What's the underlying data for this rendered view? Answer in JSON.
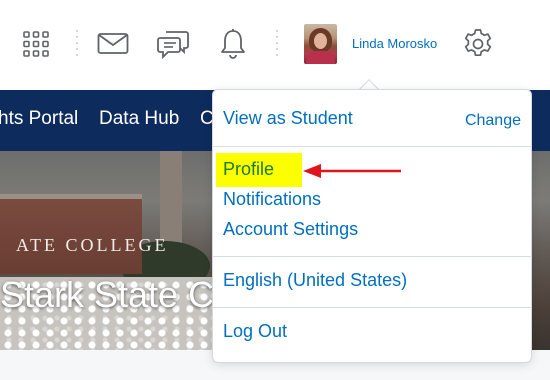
{
  "header": {
    "user_name": "Linda Morosko",
    "icons": [
      "grid-icon",
      "mail-icon",
      "chat-icon",
      "bell-icon",
      "gear-icon"
    ]
  },
  "nav": {
    "items": [
      "hts Portal",
      "Data Hub",
      "C"
    ]
  },
  "banner": {
    "title": "Stark State C",
    "sign_text": "ATE COLLEGE"
  },
  "dropdown": {
    "view_as": "View as Student",
    "change": "Change",
    "profile": "Profile",
    "notifications": "Notifications",
    "account_settings": "Account Settings",
    "language": "English (United States)",
    "logout": "Log Out"
  },
  "colors": {
    "nav_bg": "#0e2b5e",
    "link": "#006fbf",
    "highlight": "#fbff00",
    "annotation_arrow": "#e0141e"
  }
}
